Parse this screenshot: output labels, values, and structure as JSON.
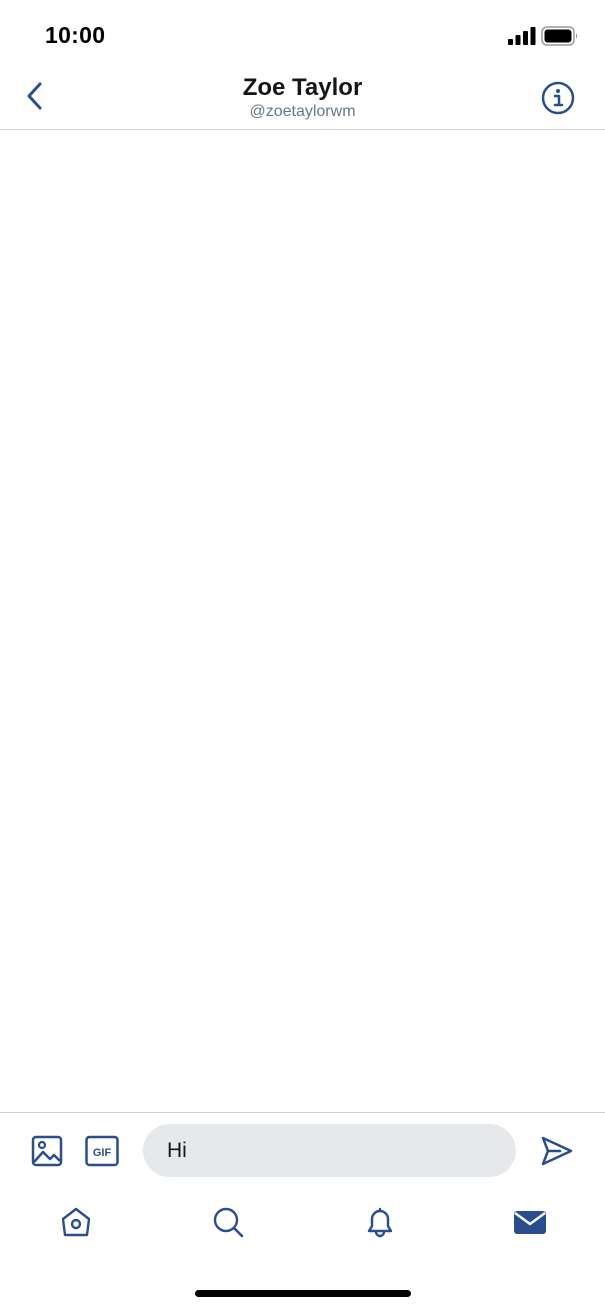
{
  "status_bar": {
    "time": "10:00",
    "signal_icon": "cellular-signal-icon",
    "battery_icon": "battery-icon"
  },
  "header": {
    "back_icon": "chevron-left-icon",
    "title": "Zoe Taylor",
    "handle": "@zoetaylorwm",
    "info_icon": "info-icon"
  },
  "composer": {
    "media_icon": "image-icon",
    "gif_label": "GIF",
    "input_value": "Hi",
    "send_icon": "send-icon"
  },
  "tab_bar": {
    "items": [
      {
        "name": "home",
        "icon": "home-icon",
        "active": false
      },
      {
        "name": "search",
        "icon": "search-icon",
        "active": false
      },
      {
        "name": "notifications",
        "icon": "bell-icon",
        "active": false
      },
      {
        "name": "messages",
        "icon": "mail-icon",
        "active": true
      }
    ]
  },
  "colors": {
    "accent": "#2a4d8f",
    "text_primary": "#14171a",
    "text_secondary": "#657786",
    "input_background": "#e6e9ec",
    "divider": "#d0d4d8"
  }
}
